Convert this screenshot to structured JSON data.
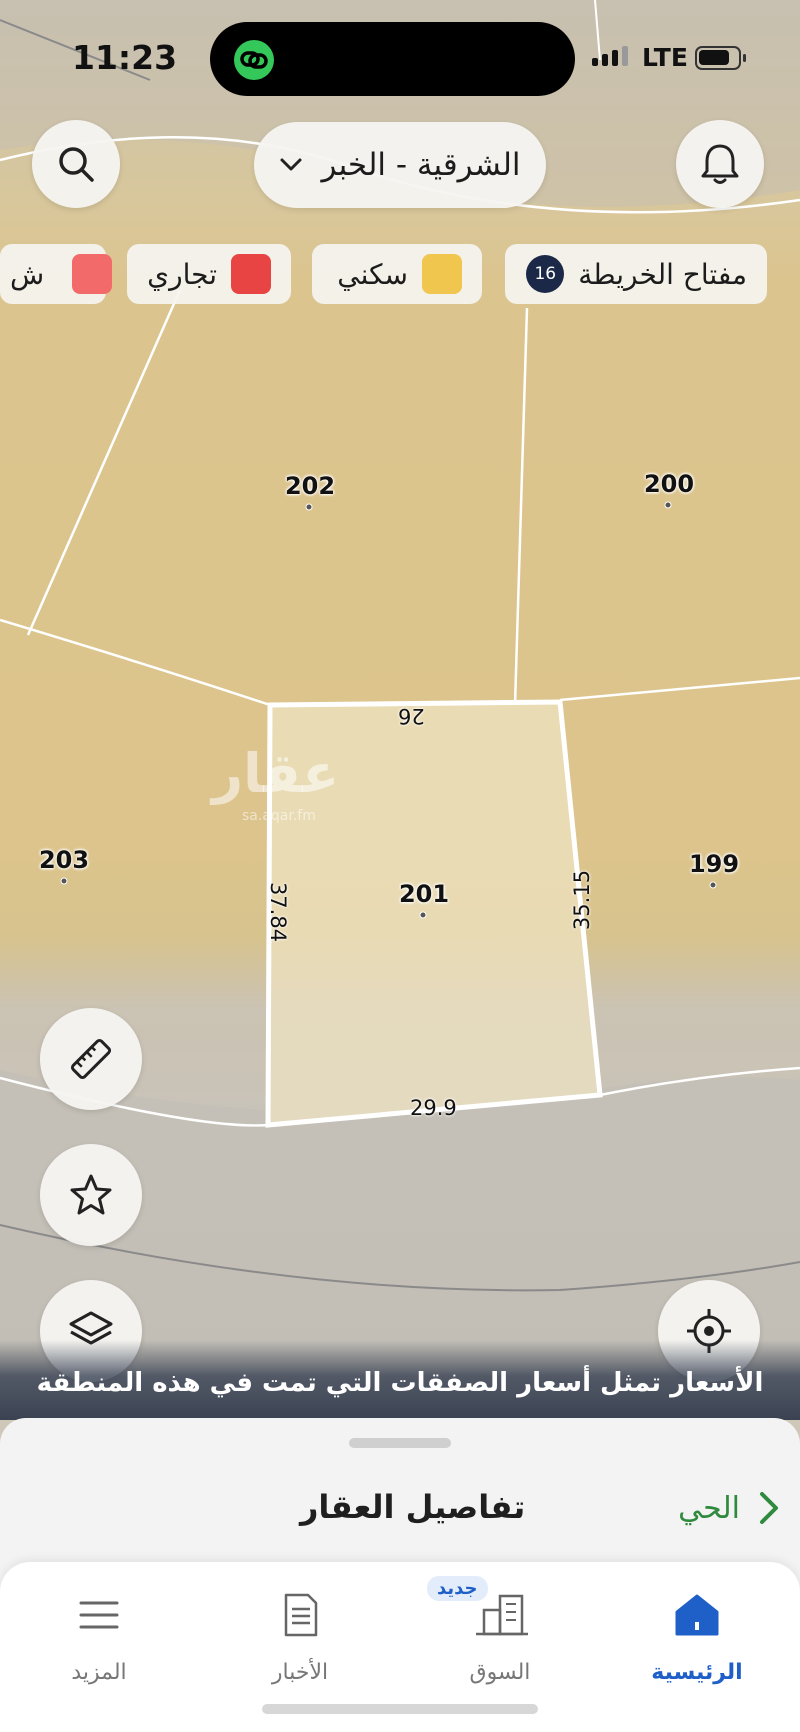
{
  "status_bar": {
    "time": "11:23",
    "network": "LTE"
  },
  "header": {
    "location": "الشرقية - الخبر"
  },
  "legend": {
    "map_key_label": "مفتاح الخريطة",
    "map_key_count": "16",
    "residential_label": "سكني",
    "commercial_label": "تجاري",
    "cut_label": "ش",
    "colors": {
      "residential": "#f0c64e",
      "commercial": "#e84444",
      "cut": "#f26a6a"
    }
  },
  "map": {
    "parcels": [
      "202",
      "200",
      "203",
      "201",
      "199"
    ],
    "dimensions": {
      "top": "26",
      "left": "37.84",
      "right": "35.15",
      "bottom": "29.9"
    },
    "watermark": "عقار",
    "watermark_sub": "sa.aqar.fm",
    "price_note": "الأسعار تمثل أسعار الصفقات التي تمت في هذه المنطقة"
  },
  "sheet": {
    "title": "تفاصيل العقار",
    "district_link": "الحي"
  },
  "tabs": {
    "home": "الرئيسية",
    "market": "السوق",
    "market_badge": "جديد",
    "news": "الأخبار",
    "more": "المزيد",
    "active_color": "#1f5fc8"
  }
}
